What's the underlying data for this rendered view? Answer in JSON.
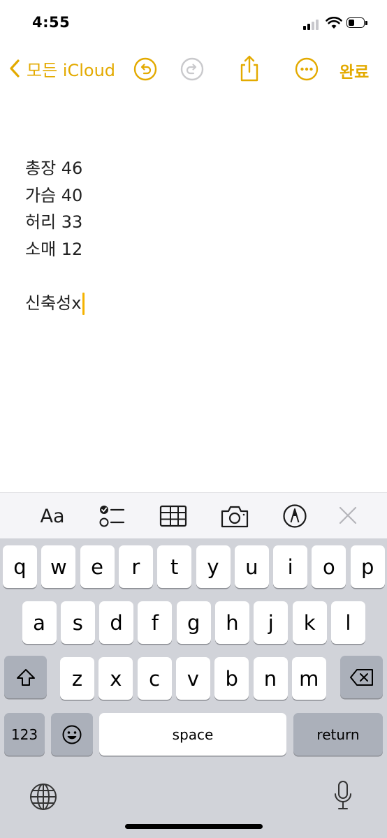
{
  "status_bar": {
    "time": "4:55"
  },
  "nav": {
    "back_label": "모든 iCloud",
    "done_label": "완료"
  },
  "note": {
    "lines": [
      "총장 46",
      "가슴 40",
      "허리 33",
      "소매 12"
    ],
    "current_line": "신축성x"
  },
  "toolbar": {
    "format_label": "Aa",
    "icons": [
      "checklist-icon",
      "table-icon",
      "camera-icon",
      "markup-icon",
      "close-icon"
    ]
  },
  "keyboard": {
    "row1": [
      "q",
      "w",
      "e",
      "r",
      "t",
      "y",
      "u",
      "i",
      "o",
      "p"
    ],
    "row2": [
      "a",
      "s",
      "d",
      "f",
      "g",
      "h",
      "j",
      "k",
      "l"
    ],
    "row3": [
      "z",
      "x",
      "c",
      "v",
      "b",
      "n",
      "m"
    ],
    "numbers_label": "123",
    "space_label": "space",
    "return_label": "return"
  },
  "colors": {
    "accent": "#e3aa00",
    "keyboard_bg": "#d1d3d9",
    "cursor": "#f5b300"
  }
}
